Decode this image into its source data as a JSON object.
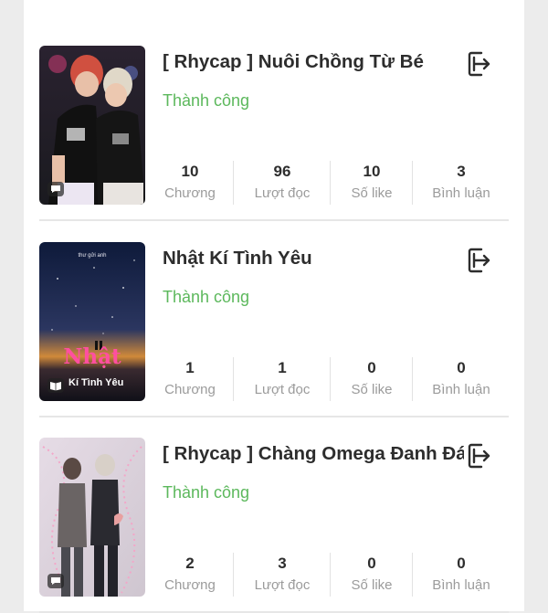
{
  "stories": [
    {
      "title": "[ Rhycap ] Nuôi Chồng Từ Bé",
      "status": "Thành công",
      "cover_badge_icon": "chat-bubble-icon",
      "stats": [
        {
          "value": "10",
          "label": "Chương"
        },
        {
          "value": "96",
          "label": "Lượt đọc"
        },
        {
          "value": "10",
          "label": "Số like"
        },
        {
          "value": "3",
          "label": "Bình luận"
        }
      ]
    },
    {
      "title": "Nhật Kí Tình Yêu",
      "status": "Thành công",
      "cover_badge_icon": "book-icon",
      "cover_text": {
        "top": "thư gửi anh",
        "main": "Nhật",
        "sub": "Kí Tình Yêu"
      },
      "stats": [
        {
          "value": "1",
          "label": "Chương"
        },
        {
          "value": "1",
          "label": "Lượt đọc"
        },
        {
          "value": "0",
          "label": "Số like"
        },
        {
          "value": "0",
          "label": "Bình luận"
        }
      ]
    },
    {
      "title": "[ Rhycap ] Chàng Omega Đanh Đá",
      "status": "Thành công",
      "cover_badge_icon": "chat-bubble-icon",
      "stats": [
        {
          "value": "2",
          "label": "Chương"
        },
        {
          "value": "3",
          "label": "Lượt đọc"
        },
        {
          "value": "0",
          "label": "Số like"
        },
        {
          "value": "0",
          "label": "Bình luận"
        }
      ]
    }
  ],
  "colors": {
    "status": "#5cb85c",
    "text": "#2d2d2d",
    "label": "#9b9b9b",
    "divider": "#e6e6e6"
  },
  "action_icon": "exit-icon"
}
